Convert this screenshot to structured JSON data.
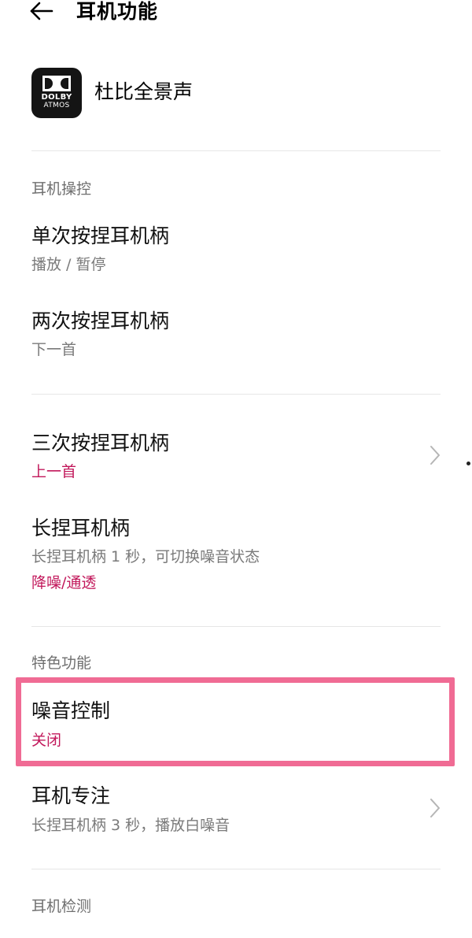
{
  "header": {
    "back_icon": "back-arrow-icon",
    "title": "耳机功能"
  },
  "dolby": {
    "logo_line1": "DOLBY",
    "logo_line2": "ATMOS",
    "label": "杜比全景声"
  },
  "sections": {
    "controls_header": "耳机操控",
    "features_header": "特色功能",
    "detection_header": "耳机检测"
  },
  "items": {
    "single_press": {
      "title": "单次按捏耳机柄",
      "value": "播放 / 暂停"
    },
    "double_press": {
      "title": "两次按捏耳机柄",
      "value": "下一首"
    },
    "triple_press": {
      "title": "三次按捏耳机柄",
      "value": "上一首"
    },
    "long_press": {
      "title": "长捏耳机柄",
      "description": "长捏耳机柄 1 秒，可切换噪音状态",
      "value": "降噪/通透"
    },
    "noise_control": {
      "title": "噪音控制",
      "value": "关闭"
    },
    "focus": {
      "title": "耳机专注",
      "description": "长捏耳机柄 3 秒，播放白噪音"
    }
  },
  "colors": {
    "accent": "#c2185b",
    "highlight": "#f06b94",
    "secondary_text": "#7a7a7a"
  }
}
